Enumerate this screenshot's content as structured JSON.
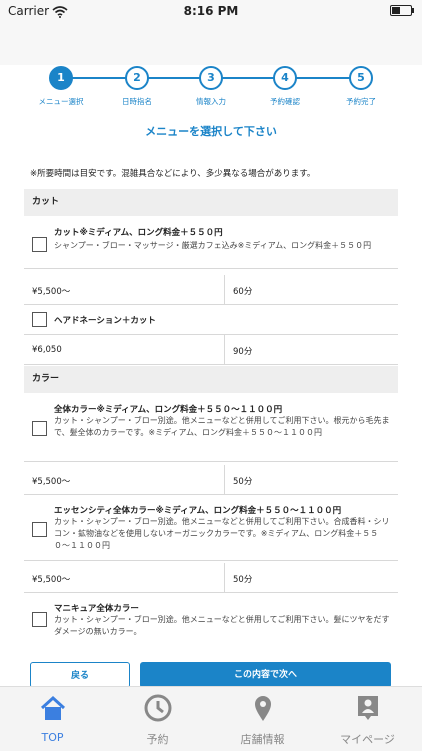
{
  "status_bar": {
    "carrier": "Carrier",
    "time": "8:16 PM"
  },
  "steps": [
    {
      "number": "1",
      "label": "メニュー選択",
      "active": true
    },
    {
      "number": "2",
      "label": "日時指名",
      "active": false
    },
    {
      "number": "3",
      "label": "情報入力",
      "active": false
    },
    {
      "number": "4",
      "label": "予約確認",
      "active": false
    },
    {
      "number": "5",
      "label": "予約完了",
      "active": false
    }
  ],
  "heading": "メニューを選択して下さい",
  "note": "※所要時間は目安です。混雑具合などにより、多少異なる場合があります。",
  "sections": {
    "cut": "カット",
    "color": "カラー"
  },
  "items": [
    {
      "name": "カット※ミディアム、ロング料金＋５５０円",
      "desc": "シャンプー・ブロー・マッサージ・厳選カフェ込み※ミディアム、ロング料金＋５５０円",
      "price": "¥5,500〜",
      "duration": "60分"
    },
    {
      "name": "ヘアドネーション＋カット",
      "desc": "",
      "price": "¥6,050",
      "duration": "90分"
    },
    {
      "name": "全体カラー※ミディアム、ロング料金＋５５０〜１１００円",
      "desc": "カット・シャンプー・ブロー別途。他メニューなどと併用してご利用下さい。根元から毛先まで、髪全体のカラーです。※ミディアム、ロング料金＋５５０〜１１００円",
      "price": "¥5,500〜",
      "duration": "50分"
    },
    {
      "name": "エッセンシティ全体カラー※ミディアム、ロング料金＋５５０〜１１００円",
      "desc": "カット・シャンプー・ブロー別途。他メニューなどと併用してご利用下さい。合成香料・シリコン・鉱物油などを使用しないオーガニックカラーです。※ミディアム、ロング料金＋５５０〜１１００円",
      "price": "¥5,500〜",
      "duration": "50分"
    },
    {
      "name": "マニキュア全体カラー",
      "desc": "カット・シャンプー・ブロー別途。他メニューなどと併用してご利用下さい。髪にツヤをだすダメージの無いカラー。",
      "price": "",
      "duration": ""
    }
  ],
  "actions": {
    "back": "戻る",
    "next": "この内容で次へ"
  },
  "tabs": [
    {
      "label": "TOP",
      "icon": "home-icon",
      "active": true
    },
    {
      "label": "予約",
      "icon": "clock-icon",
      "active": false
    },
    {
      "label": "店舗情報",
      "icon": "map-pin-icon",
      "active": false
    },
    {
      "label": "マイページ",
      "icon": "profile-badge-icon",
      "active": false
    }
  ],
  "colors": {
    "accent": "#1b84c8",
    "tab_active": "#3b7fe0",
    "tab_inactive": "#888888"
  }
}
